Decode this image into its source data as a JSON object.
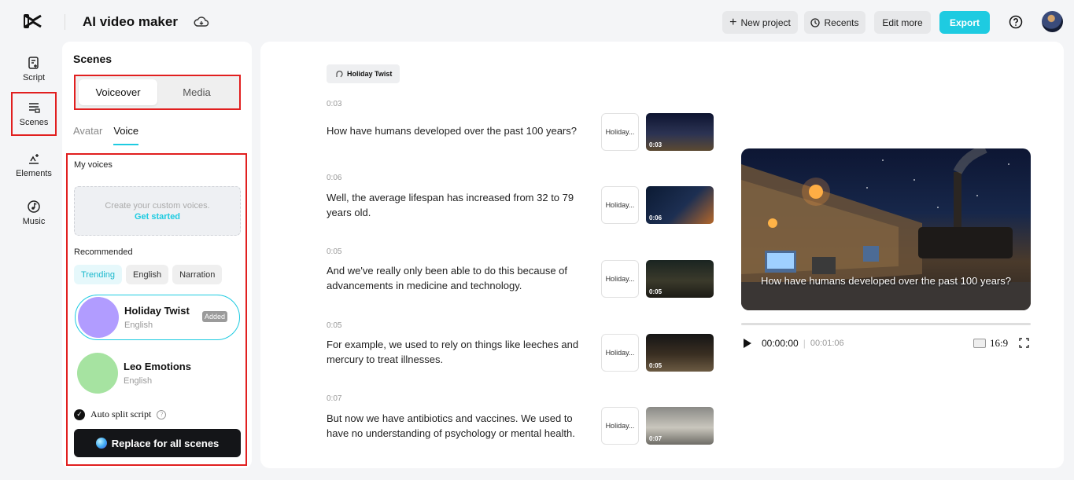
{
  "app": {
    "title": "AI video maker"
  },
  "toolbar": {
    "new_project": "New project",
    "recents": "Recents",
    "edit_more": "Edit more",
    "export": "Export"
  },
  "rail": [
    {
      "label": "Script",
      "icon": "script-icon"
    },
    {
      "label": "Scenes",
      "icon": "scenes-icon"
    },
    {
      "label": "Elements",
      "icon": "elements-icon"
    },
    {
      "label": "Music",
      "icon": "music-icon"
    }
  ],
  "panel": {
    "title": "Scenes",
    "segments": [
      "Voiceover",
      "Media"
    ],
    "subtabs": [
      "Avatar",
      "Voice"
    ],
    "my_voices_label": "My voices",
    "create_text": "Create your custom voices.",
    "get_started": "Get started",
    "recommended_label": "Recommended",
    "chips": [
      "Trending",
      "English",
      "Narration"
    ],
    "voices": [
      {
        "name": "Holiday Twist",
        "lang": "English",
        "badge": "Added",
        "color": "#b19cff"
      },
      {
        "name": "Leo Emotions",
        "lang": "English",
        "badge": "",
        "color": "#a6e3a1"
      }
    ],
    "auto_split": "Auto split script",
    "replace_button": "Replace for all scenes"
  },
  "main": {
    "voice_tag": "Holiday Twist",
    "scenes": [
      {
        "time": "0:03",
        "text": "How have humans developed over the past 100 years?",
        "voice": "Holiday...",
        "dur": "0:03"
      },
      {
        "time": "0:06",
        "text": "Well, the average lifespan has increased from 32 to 79 years old.",
        "voice": "Holiday...",
        "dur": "0:06"
      },
      {
        "time": "0:05",
        "text": "And we've really only been able to do this because of advancements in medicine and technology.",
        "voice": "Holiday...",
        "dur": "0:05"
      },
      {
        "time": "0:05",
        "text": "For example, we used to rely on things like leeches and mercury to treat illnesses.",
        "voice": "Holiday...",
        "dur": "0:05"
      },
      {
        "time": "0:07",
        "text": "But now we have antibiotics and vaccines. We used to have no understanding of psychology or mental health.",
        "voice": "Holiday...",
        "dur": "0:07"
      }
    ]
  },
  "player": {
    "caption": "How have humans developed over the past 100 years?",
    "current": "00:00:00",
    "total": "00:01:06",
    "ratio": "16:9"
  },
  "colors": {
    "accent": "#1ecbe1",
    "highlight": "#e11f1f"
  }
}
